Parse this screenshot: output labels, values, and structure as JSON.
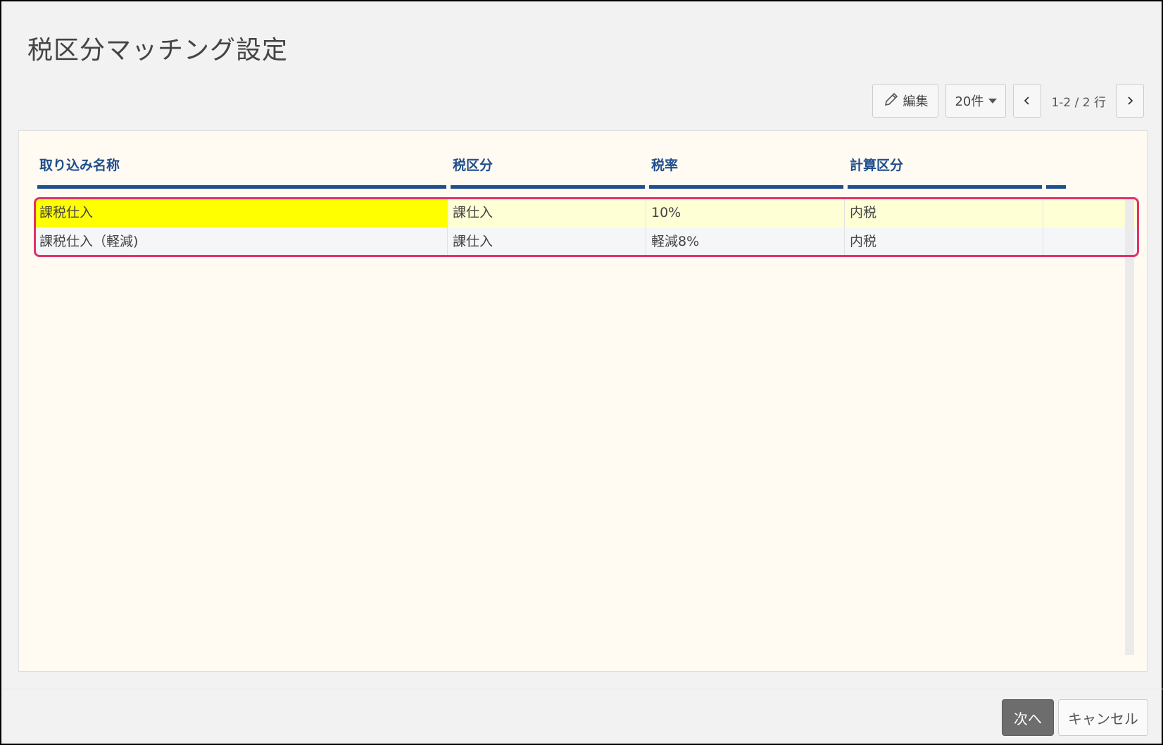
{
  "page": {
    "title": "税区分マッチング設定"
  },
  "toolbar": {
    "edit_label": "編集",
    "rows_per_page": "20件",
    "pager_text": "1-2 / 2 行"
  },
  "table": {
    "headers": [
      "取り込み名称",
      "税区分",
      "税率",
      "計算区分"
    ],
    "rows": [
      [
        "課税仕入",
        "課仕入",
        "10%",
        "内税"
      ],
      [
        "課税仕入（軽減)",
        "課仕入",
        "軽減8%",
        "内税"
      ]
    ]
  },
  "footer": {
    "next_label": "次へ",
    "cancel_label": "キャンセル"
  },
  "colors": {
    "header_blue": "#1f4e8c",
    "highlight_border": "#e0336a",
    "selected_cell": "#ffff00"
  }
}
